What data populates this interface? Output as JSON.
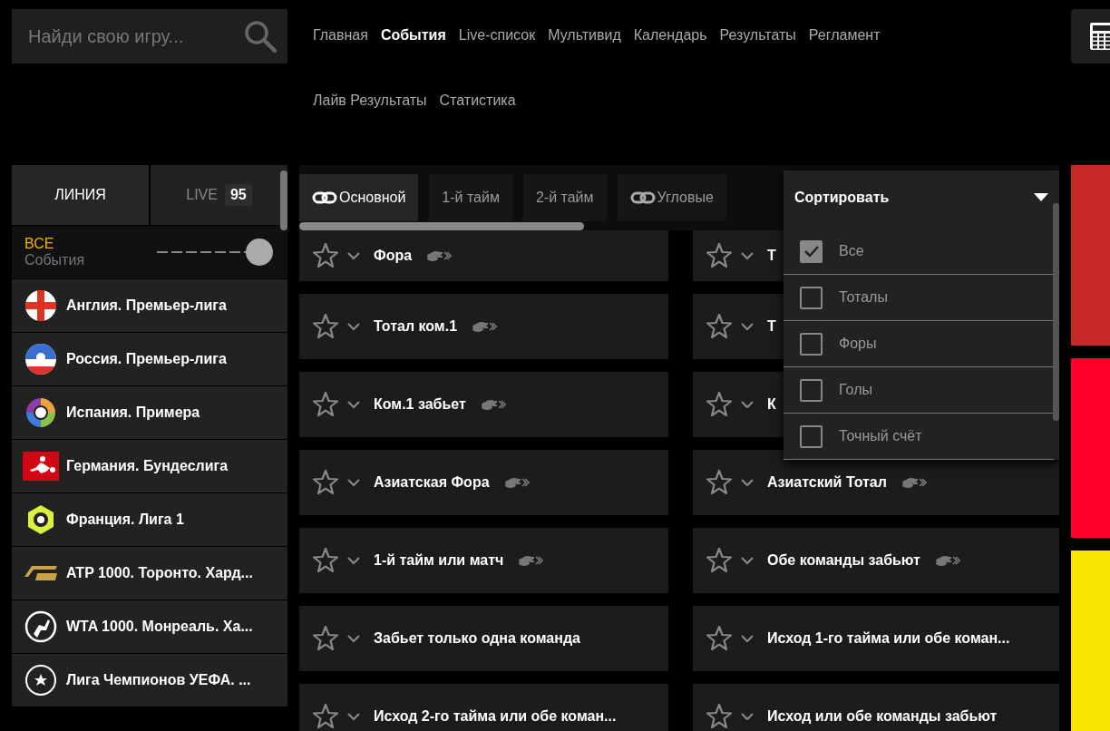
{
  "search": {
    "placeholder": "Найди свою игру..."
  },
  "nav": [
    {
      "label": "Главная",
      "selected": false
    },
    {
      "label": "События",
      "selected": true
    },
    {
      "label": "Live-список",
      "selected": false
    },
    {
      "label": "Мультивид",
      "selected": false
    },
    {
      "label": "Календарь",
      "selected": false
    },
    {
      "label": "Результаты",
      "selected": false
    },
    {
      "label": "Регламент",
      "selected": false
    },
    {
      "label": "Лайв Результаты",
      "selected": false
    },
    {
      "label": "Статистика",
      "selected": false
    }
  ],
  "sidebar": {
    "tabs": [
      {
        "label": "ЛИНИЯ",
        "selected": true
      },
      {
        "label": "LIVE",
        "count": "95",
        "selected": false
      }
    ],
    "filter": {
      "value": "ВСЕ",
      "label": "События",
      "level": 1
    },
    "items": [
      {
        "label": "Англия. Премьер-лига"
      },
      {
        "label": "Россия. Премьер-лига"
      },
      {
        "label": "Испания. Примера"
      },
      {
        "label": "Германия. Бундеслига"
      },
      {
        "label": "Франция. Лига 1"
      },
      {
        "label": "ATP 1000. Торонто. Хард..."
      },
      {
        "label": "WTA 1000. Монреаль. Ха..."
      },
      {
        "label": "Лига Чемпионов УЕФА. ..."
      }
    ]
  },
  "market_tabs": [
    {
      "label": "Основной",
      "linked": true,
      "selected": true
    },
    {
      "label": "1-й тайм",
      "linked": false,
      "selected": false
    },
    {
      "label": "2-й тайм",
      "linked": false,
      "selected": false
    },
    {
      "label": "Угловые",
      "linked": true,
      "selected": false
    }
  ],
  "markets": [
    {
      "title": "Фора",
      "coins": true
    },
    {
      "title": "Т",
      "coins": false
    },
    {
      "title": "Тотал ком.1",
      "coins": true
    },
    {
      "title": "Т",
      "coins": false
    },
    {
      "title": "Ком.1 забьет",
      "coins": true
    },
    {
      "title": "К",
      "coins": false
    },
    {
      "title": "Азиатская Фора",
      "coins": true
    },
    {
      "title": "Азиатский Тотал",
      "coins": true
    },
    {
      "title": "1-й тайм или матч",
      "coins": true
    },
    {
      "title": "Обе команды забьют",
      "coins": true
    },
    {
      "title": "Забьет только одна команда",
      "coins": false
    },
    {
      "title": "Исход 1-го тайма или обе коман...",
      "coins": false
    },
    {
      "title": "Исход 2-го тайма или обе коман...",
      "coins": false
    },
    {
      "title": "Исход или обе команды забьют",
      "coins": false
    }
  ],
  "sort": {
    "title": "Сортировать",
    "options": [
      {
        "label": "Все",
        "checked": true
      },
      {
        "label": "Тоталы",
        "checked": false
      },
      {
        "label": "Форы",
        "checked": false
      },
      {
        "label": "Голы",
        "checked": false
      },
      {
        "label": "Точный счёт",
        "checked": false
      }
    ]
  },
  "banners": [
    {
      "color": "#c62828"
    },
    {
      "color": "#ff0028"
    },
    {
      "color": "#f7e400"
    }
  ]
}
